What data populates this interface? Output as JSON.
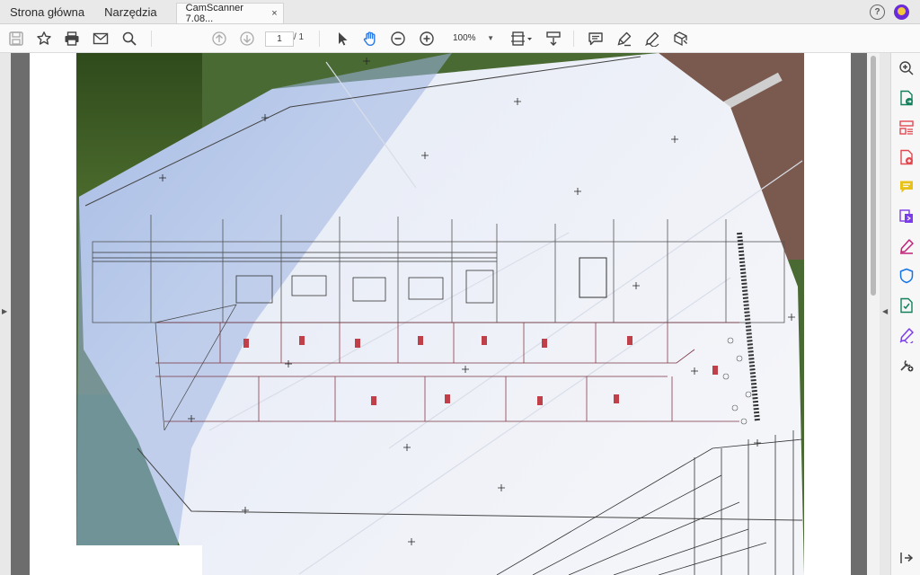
{
  "tabs": {
    "home": "Strona główna",
    "tools": "Narzędzia",
    "document": "CamScanner 7.08...",
    "close": "×"
  },
  "toolbar": {
    "page_current": "1",
    "page_total": "/ 1",
    "zoom": "100%"
  },
  "icons": {
    "toolbar": [
      "save-icon",
      "bookmark-star-icon",
      "print-icon",
      "email-icon",
      "search-icon",
      "page-up-icon",
      "page-down-icon",
      "select-arrow-icon",
      "hand-icon",
      "zoom-out-icon",
      "zoom-in-icon",
      "fit-page-icon",
      "scroll-mode-icon",
      "comment-icon",
      "highlight-icon",
      "sign-icon",
      "fill-sign-icon"
    ],
    "tool_pane": [
      "zoom-icon",
      "export-pdf-icon",
      "organize-pages-icon",
      "create-pdf-icon",
      "comment-tool-icon",
      "edit-pdf-icon",
      "fill-sign-tool-icon",
      "protect-icon",
      "optimize-icon",
      "sign-tool-icon",
      "more-tools-icon",
      "collapse-pane-icon"
    ]
  },
  "colors": {
    "accent_blue": "#1473e6",
    "hand_tool_blue": "#2d7be5",
    "avatar_purple": "#6c2bd9",
    "export_green": "#12805c",
    "organize_red": "#e34850",
    "comment_yellow": "#e8c21a",
    "edit_purple": "#7c3aed",
    "protect_blue": "#1473e6"
  }
}
